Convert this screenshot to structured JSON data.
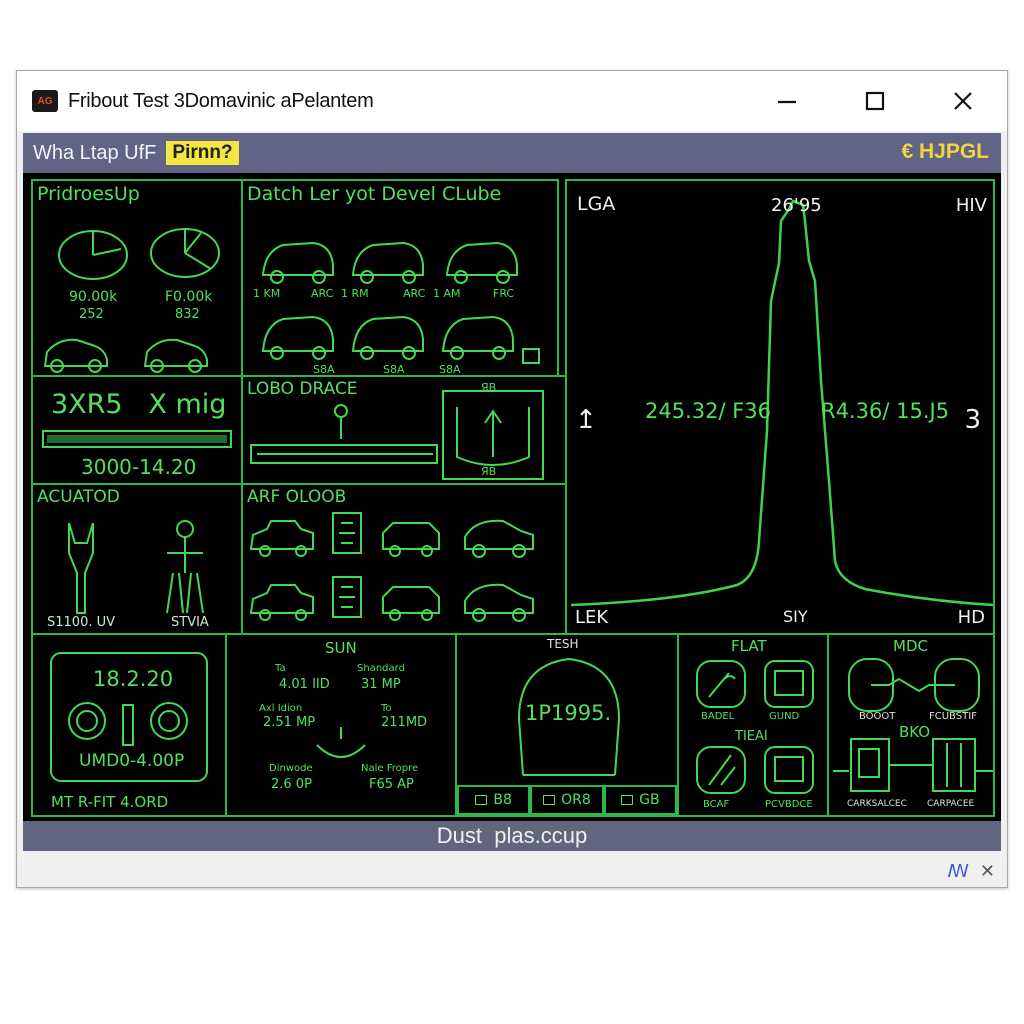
{
  "window": {
    "icon_label": "AG",
    "title": "Fribout Test 3Domavinic aPelantem"
  },
  "appbar": {
    "title": "Wha Ltap UfF",
    "badge": "Pirnn?",
    "right_label": "€ HJPGL"
  },
  "panels": {
    "properties": {
      "title": "PridroesUp",
      "left_value": "90.00k",
      "left_sub": "252",
      "right_value": "F0.00k",
      "right_sub": "832"
    },
    "datch": {
      "title": "Datch Ler yot Devel CLube",
      "row1_labels": [
        "1 KM",
        "ARC",
        "1 RM",
        "ARC",
        "1 AM",
        "FRC"
      ],
      "row2_labels": [
        "S8A",
        "S8A",
        "S8A"
      ]
    },
    "rpm": {
      "big": "3XR5   X mig",
      "sub": "3000-14.20"
    },
    "lobo": {
      "title": "LOBO DRACE",
      "gauge_top": "ЯB",
      "gauge_bottom": "ЯB"
    },
    "acuator": {
      "title": "ACUATOD",
      "left_label": "S1100. UV",
      "right_label": "STVIA"
    },
    "arf": {
      "title": "ARF OLOOB"
    },
    "graph": {
      "tl": "LGA",
      "top": "26'95",
      "tr": "HIV",
      "left_value": "245.32/ F36",
      "right_value": "R4.36/ 15.J5",
      "right_marker": "3",
      "left_marker": "↥",
      "bl": "LEK",
      "bottom": "SIY",
      "br": "HD"
    },
    "monitor": {
      "value": "18.2.20",
      "sub": "UMD0-4.00P",
      "footer": "MT R-FIT  4.ORD"
    },
    "sun": {
      "title": "SUN",
      "cells": [
        "Ta",
        "Shandard",
        "4.01 IID",
        "31 MP",
        "Axl Idion",
        "To",
        "2.51 MP",
        "211MD",
        "Dinwode",
        "Nale Fropre",
        "2.6 0P",
        "F65 AP"
      ]
    },
    "tesh": {
      "title": "TESH",
      "value": "1P1995.",
      "tabs": [
        "B8",
        "OR8",
        "GB"
      ]
    },
    "flat": {
      "title": "FLAT",
      "labels": [
        "BADEL",
        "GUND",
        "TIEAI",
        "BCAF",
        "PCVBDCE"
      ]
    },
    "mdc": {
      "title": "MDC",
      "labels": [
        "BOOOT",
        "FCUBSTIF",
        "BKO",
        "CARKSALCEC",
        "CARPACEE"
      ]
    }
  },
  "footer": {
    "title": "Dust  plas.ccup"
  },
  "status": {
    "glyph": "ꟿ",
    "close": "✕"
  }
}
